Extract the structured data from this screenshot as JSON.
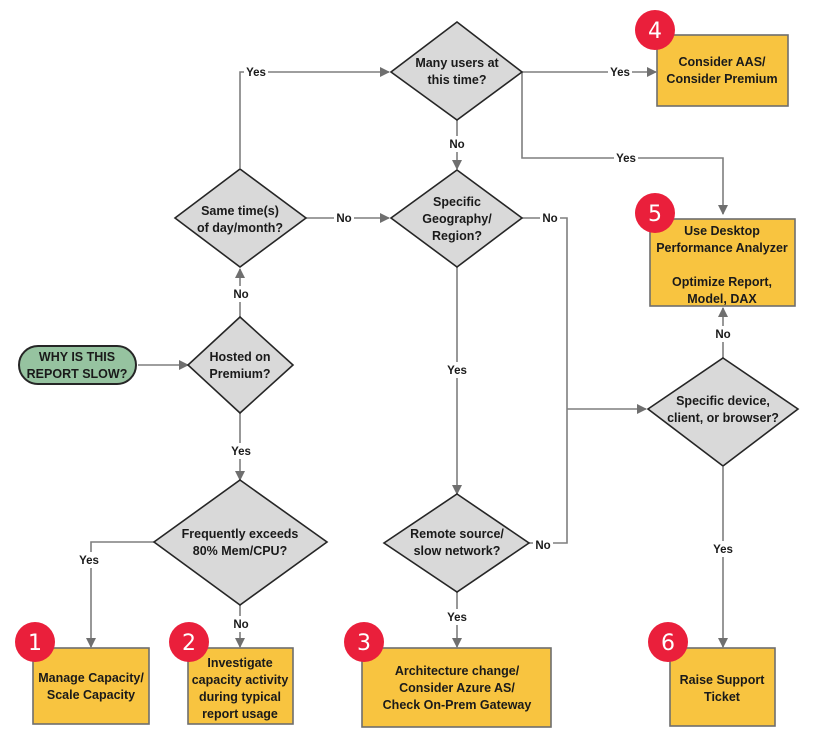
{
  "diagram": {
    "title": "Why is this report slow? troubleshooting flowchart",
    "colors": {
      "decision_fill": "#d9d9d9",
      "outcome_fill": "#f8c440",
      "start_fill": "#96c3a0",
      "badge_fill": "#ea1f3b",
      "connector": "#7f7f7f"
    },
    "start": {
      "lines": [
        "WHY IS THIS",
        "REPORT SLOW?"
      ]
    },
    "decisions": {
      "hosted_premium": {
        "lines": [
          "Hosted on",
          "Premium?"
        ]
      },
      "same_time": {
        "lines": [
          "Same time(s)",
          "of day/month?"
        ]
      },
      "many_users": {
        "lines": [
          "Many users at",
          "this time?"
        ]
      },
      "geography": {
        "lines": [
          "Specific",
          "Geography/",
          "Region?"
        ]
      },
      "exceeds": {
        "lines": [
          "Frequently exceeds",
          "80% Mem/CPU?"
        ]
      },
      "remote": {
        "lines": [
          "Remote source/",
          "slow network?"
        ]
      },
      "device": {
        "lines": [
          "Specific device,",
          "client, or browser?"
        ]
      }
    },
    "outcomes": {
      "o1": {
        "badge": "1",
        "lines": [
          "Manage Capacity/",
          "Scale Capacity"
        ]
      },
      "o2": {
        "badge": "2",
        "lines": [
          "Investigate",
          "capacity activity",
          "during typical",
          "report usage"
        ]
      },
      "o3": {
        "badge": "3",
        "lines": [
          "Architecture change/",
          "Consider Azure AS/",
          "Check On-Prem Gateway"
        ]
      },
      "o4": {
        "badge": "4",
        "lines": [
          "Consider AAS/",
          "Consider Premium"
        ]
      },
      "o5": {
        "badge": "5",
        "lines": [
          "Use Desktop",
          "Performance Analyzer",
          "",
          "Optimize Report,",
          "Model, DAX"
        ]
      },
      "o6": {
        "badge": "6",
        "lines": [
          "Raise Support",
          "Ticket"
        ]
      }
    },
    "edge_labels": {
      "premium_no": "No",
      "premium_yes": "Yes",
      "same_time_yes": "Yes",
      "same_time_no": "No",
      "many_users_yes_aas": "Yes",
      "many_users_yes_desktop": "Yes",
      "many_users_no": "No",
      "geography_no": "No",
      "geography_yes": "Yes",
      "exceeds_yes": "Yes",
      "exceeds_no": "No",
      "remote_yes": "Yes",
      "remote_no": "No",
      "device_no": "No",
      "device_yes": "Yes"
    }
  }
}
